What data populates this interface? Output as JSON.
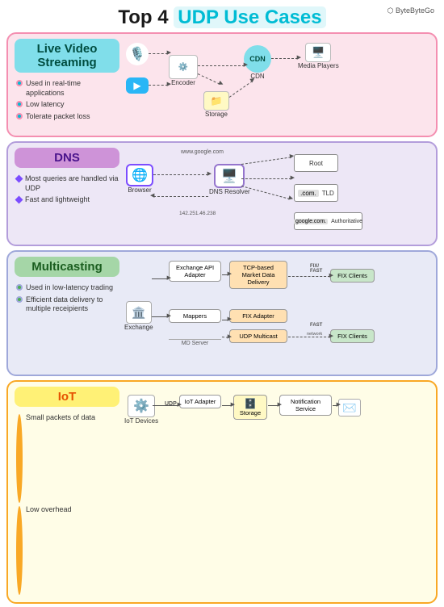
{
  "header": {
    "prefix": "Top 4 ",
    "highlight": "UDP Use Cases",
    "brand": "⬡ ByteByteGo"
  },
  "sections": [
    {
      "id": "sec1",
      "title": "Live Video Streaming",
      "bullets": [
        "Used in real-time applications",
        "Low latency",
        "Tolerate packet loss"
      ],
      "diagram_nodes": [
        "Encoder",
        "Storage",
        "CDN",
        "Media Players"
      ]
    },
    {
      "id": "sec2",
      "title": "DNS",
      "bullets": [
        "Most queries are handled via UDP",
        "Fast and lightweight"
      ],
      "diagram_nodes": [
        "Browser",
        "DNS Resolver",
        "Root",
        "TLD",
        "Authoritative"
      ]
    },
    {
      "id": "sec3",
      "title": "Multicasting",
      "bullets": [
        "Used in low-latency trading",
        "Efficient data delivery to multiple receipients"
      ],
      "diagram_nodes": [
        "Exchange",
        "Exchange API Adapter",
        "Mappers",
        "TCP-based Market Data Delivery",
        "FIX Adapter",
        "UDP Multicast",
        "FIX Clients",
        "FIX Clients"
      ]
    },
    {
      "id": "sec4",
      "title": "IoT",
      "bullets": [
        "Small packets of data",
        "Low overhead"
      ],
      "diagram_nodes": [
        "IoT Devices",
        "IoT Adapter",
        "Storage",
        "Notification Service"
      ]
    }
  ]
}
